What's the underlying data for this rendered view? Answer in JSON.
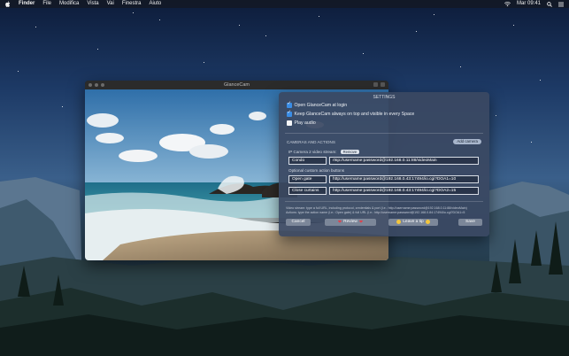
{
  "menubar": {
    "apple_icon": "apple-icon",
    "app_name": "Finder",
    "items": [
      "File",
      "Modifica",
      "Vista",
      "Vai",
      "Finestra",
      "Aiuto"
    ],
    "wifi_icon": "wifi-icon",
    "clock": "Mar 09:41",
    "search_icon": "search-icon",
    "list_icon": "list-icon"
  },
  "window": {
    "title": "GlanceCam"
  },
  "settings": {
    "title": "SETTINGS",
    "options": [
      {
        "label": "Open GlanceCam at login",
        "checked": true
      },
      {
        "label": "Keep GlanceCam always on top and visible in every Space",
        "checked": true
      },
      {
        "label": "Play audio",
        "checked": false
      }
    ],
    "section_title": "CAMERAS AND ACTIONS",
    "add_camera_label": "Add camera",
    "stream_label": "IP Camera 2 video stream:",
    "remove_label": "Remove",
    "camera_name": "Condo",
    "camera_url": "rtsp://username:password@192.168.0.11:88/videoMain",
    "custom_actions_label": "Optional custom action buttons",
    "actions": [
      {
        "name": "Open gate",
        "url": "http://username:password@192.168.0.43:17494/io.cgi?DOA1=10"
      },
      {
        "name": "Close curtains",
        "url": "http://username:password@192.168.0.43:17494/io.cgi?DOA2=15"
      }
    ],
    "help_line1": "Video stream: type a full URL, including protocol, credentials & port (i.e.: http://username:password@192.168.0.11:88/videoMain)",
    "help_line2": "Actions: type the action name (i.e.: Open gate) & full URL (i.e.: http://username:password@192.168.0.84:17494/io.cgi?DOA1=5",
    "cancel_label": "Cancel",
    "review_label": "Review",
    "tip_label": "Leave a tip",
    "save_label": "Save"
  },
  "colors": {
    "accent": "#3a8de6",
    "panel": "#3a4862",
    "heart": "#e0404a",
    "coin": "#f2c53d"
  }
}
